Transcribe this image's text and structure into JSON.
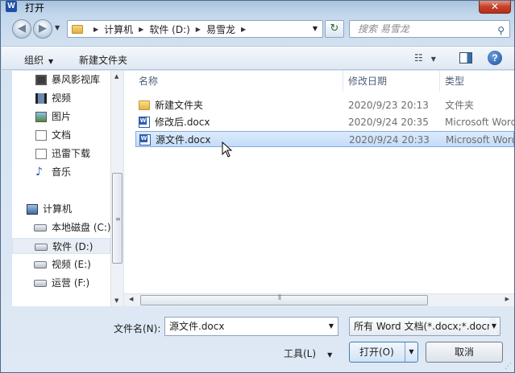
{
  "window": {
    "title": "打开",
    "app_icon": "W",
    "close": "✕"
  },
  "nav": {
    "breadcrumb": [
      "计算机",
      "软件 (D:)",
      "易雪龙"
    ],
    "search_placeholder": "搜索 易雪龙"
  },
  "toolbar": {
    "organize": "组织",
    "new_folder": "新建文件夹"
  },
  "sidebar": {
    "items": [
      {
        "label": "暴风影视库",
        "icon": "video-library-icon"
      },
      {
        "label": "视频",
        "icon": "video-icon"
      },
      {
        "label": "图片",
        "icon": "pictures-icon"
      },
      {
        "label": "文档",
        "icon": "documents-icon"
      },
      {
        "label": "迅雷下载",
        "icon": "download-icon"
      },
      {
        "label": "音乐",
        "icon": "music-icon"
      },
      {
        "label": "计算机",
        "icon": "computer-icon"
      },
      {
        "label": "本地磁盘 (C:)",
        "icon": "system-drive-icon"
      },
      {
        "label": "软件 (D:)",
        "icon": "drive-icon",
        "selected": true
      },
      {
        "label": "视频 (E:)",
        "icon": "drive-icon"
      },
      {
        "label": "运营 (F:)",
        "icon": "drive-icon"
      }
    ]
  },
  "filelist": {
    "columns": [
      "名称",
      "修改日期",
      "类型"
    ],
    "rows": [
      {
        "name": "新建文件夹",
        "date": "2020/9/23 20:13",
        "type": "文件夹",
        "icon": "folder-icon"
      },
      {
        "name": "修改后.docx",
        "date": "2020/9/24 20:35",
        "type": "Microsoft Word",
        "icon": "word-doc-icon"
      },
      {
        "name": "源文件.docx",
        "date": "2020/9/24 20:33",
        "type": "Microsoft Word",
        "icon": "word-doc-icon",
        "selected": true
      }
    ]
  },
  "bottom": {
    "filename_label": "文件名(N):",
    "filename_value": "源文件.docx",
    "filter_value": "所有 Word 文档(*.docx;*.docm",
    "tools": "工具(L)",
    "open": "打开(O)",
    "cancel": "取消"
  }
}
